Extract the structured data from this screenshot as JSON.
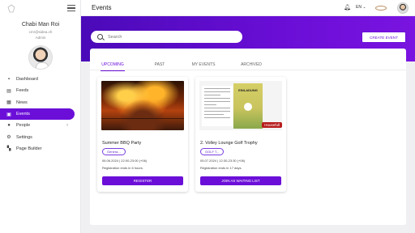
{
  "sidebar": {
    "user_name": "Chabi Man Roi",
    "user_email": "cmr@sidea.ch",
    "user_role": "Admin",
    "items": [
      {
        "label": "Dashboard",
        "icon": "dashboard-icon"
      },
      {
        "label": "Feeds",
        "icon": "feeds-icon"
      },
      {
        "label": "News",
        "icon": "news-icon"
      },
      {
        "label": "Events",
        "icon": "events-icon",
        "active": true
      },
      {
        "label": "People",
        "icon": "people-icon"
      },
      {
        "label": "Settings",
        "icon": "settings-icon"
      },
      {
        "label": "Page Builder",
        "icon": "page-builder-icon"
      }
    ]
  },
  "topbar": {
    "title": "Events",
    "language": "EN"
  },
  "search": {
    "placeholder": "Search"
  },
  "create_button": "CREATE EVENT",
  "tabs": [
    {
      "label": "UPCOMING",
      "active": true
    },
    {
      "label": "PAST"
    },
    {
      "label": "MY EVENTS"
    },
    {
      "label": "ARCHIVED"
    }
  ],
  "events": [
    {
      "title": "Summer BBQ Party",
      "chip": "Genera...",
      "date": "06.06.2024",
      "time": "22:00-23:00 (+06)",
      "registration": "Registration ends in 6 hours.",
      "button": "REGISTER",
      "badge": ""
    },
    {
      "title": "2. Volley Lounge Golf Trophy",
      "chip": "GOLF T...",
      "date": "05.07.2024",
      "time": "12:30-23:30 (+06)",
      "registration": "Registration ends in 17 days.",
      "button": "JOIN AS WAITING LIST",
      "badge": "Housefull",
      "poster_title": "EINLADUNG"
    }
  ],
  "colors": {
    "accent": "#6b0fd8",
    "hero_start": "#4a0ab8",
    "hero_end": "#7a14e0",
    "badge": "#b71c1c"
  }
}
